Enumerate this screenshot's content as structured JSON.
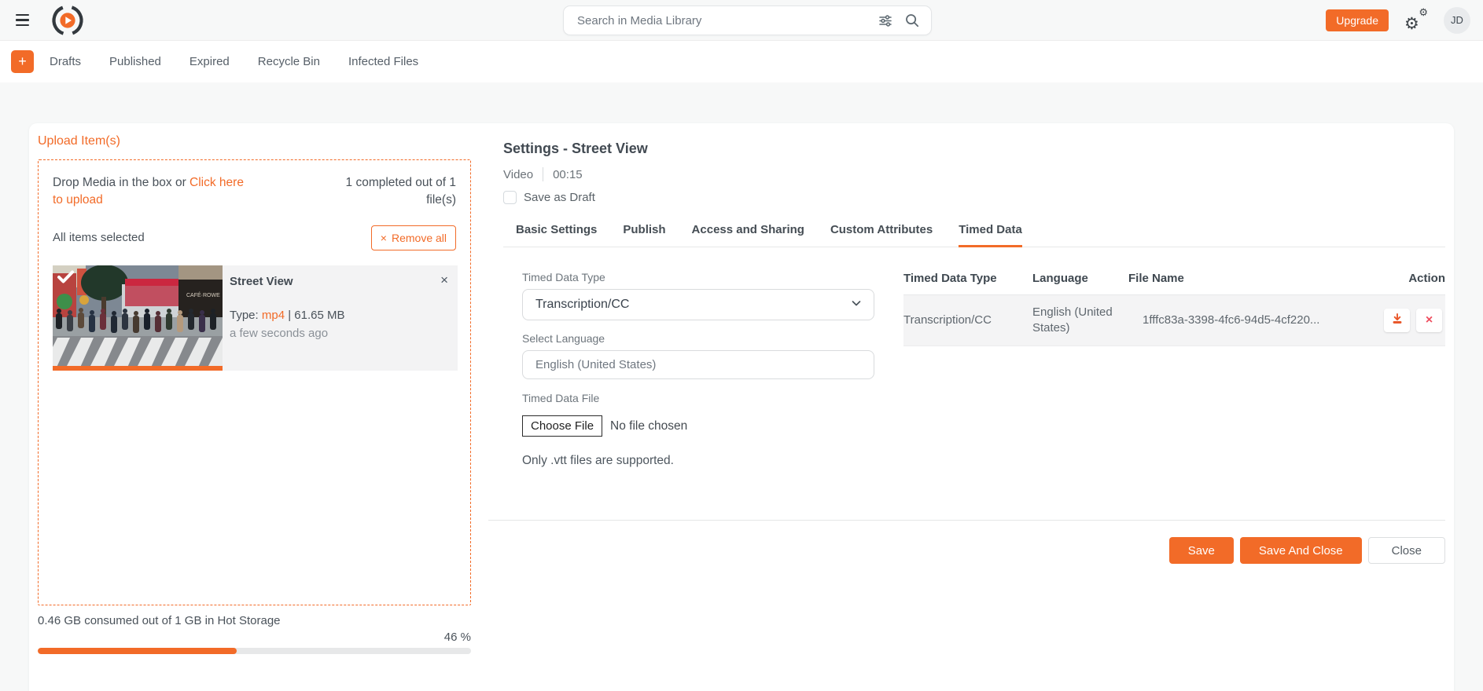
{
  "colors": {
    "accent_orange": "#f26b28",
    "delete_red": "#ee4d5e",
    "download_orange": "#e9582b",
    "progress_track": "#e7e8e9"
  },
  "icons": {
    "plus": "+",
    "close": "×",
    "gear": "⚙",
    "check": "✓"
  },
  "topbar": {
    "search": {
      "placeholder": "Search in Media Library"
    },
    "upgrade_label": "Upgrade",
    "avatar_initials": "JD"
  },
  "nav": {
    "tabs": [
      {
        "label": "Drafts"
      },
      {
        "label": "Published"
      },
      {
        "label": "Expired"
      },
      {
        "label": "Recycle Bin"
      },
      {
        "label": "Infected Files"
      }
    ]
  },
  "upload_panel": {
    "title": "Upload Item(s)",
    "drop_text_prefix": "Drop Media in the box or ",
    "drop_text_link": "Click here to upload",
    "completed_summary": "1 completed out of 1 file(s)",
    "all_selected": "All items selected",
    "remove_all_label": "Remove all",
    "file": {
      "name": "Street View",
      "type_label": "Type: ",
      "type_value": "mp4",
      "separator": " | ",
      "size": "61.65 MB",
      "uploaded_ago": "a few seconds ago"
    },
    "storage": {
      "text": "0.46 GB consumed out of 1 GB in Hot Storage",
      "percent_label": "46 %",
      "percent": 46
    }
  },
  "settings_panel": {
    "title": "Settings - Street View",
    "media_type": "Video",
    "duration": "00:15",
    "save_as_draft_label": "Save as Draft",
    "tabs": [
      {
        "label": "Basic Settings",
        "active": false
      },
      {
        "label": "Publish",
        "active": false
      },
      {
        "label": "Access and Sharing",
        "active": false
      },
      {
        "label": "Custom Attributes",
        "active": false
      },
      {
        "label": "Timed Data",
        "active": true
      }
    ],
    "form": {
      "type_label": "Timed Data Type",
      "type_value": "Transcription/CC",
      "language_label": "Select Language",
      "language_value": "English (United States)",
      "file_label": "Timed Data File",
      "choose_file_label": "Choose File",
      "no_file_text": "No file chosen",
      "hint": "Only .vtt files are supported."
    },
    "table": {
      "headers": [
        "Timed Data Type",
        "Language",
        "File Name",
        "Action"
      ],
      "rows": [
        {
          "type": "Transcription/CC",
          "language": "English (United States)",
          "file_name": "1fffc83a-3398-4fc6-94d5-4cf220..."
        }
      ]
    },
    "footer": {
      "save_label": "Save",
      "save_and_close_label": "Save And Close",
      "close_label": "Close"
    }
  }
}
